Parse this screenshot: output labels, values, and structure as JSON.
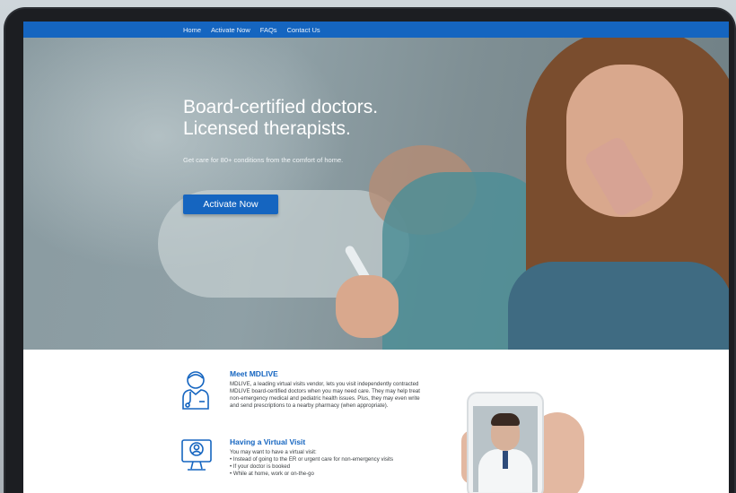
{
  "nav": {
    "items": [
      "Home",
      "Activate Now",
      "FAQs",
      "Contact Us"
    ]
  },
  "hero": {
    "title_line1": "Board-certified doctors.",
    "title_line2": "Licensed therapists.",
    "subtitle": "Get care for 80+ conditions from the comfort of home.",
    "cta_label": "Activate Now"
  },
  "sections": {
    "meet": {
      "title": "Meet MDLIVE",
      "body_lines": [
        "MDLIVE, a leading virtual visits vendor, lets you visit independently contracted",
        "MDLIVE board-certified doctors when you may need care. They may help treat",
        "non-emergency medical and pediatric health issues. Plus, they may even write",
        "and send prescriptions to a nearby pharmacy (when appropriate)."
      ],
      "icon": "doctor-icon"
    },
    "visit": {
      "title": "Having a Virtual Visit",
      "intro": "You may want to have a virtual visit:",
      "bullets": [
        "Instead of going to the ER or urgent care for non-emergency visits",
        "If your doctor is booked",
        "While at home, work or on-the-go"
      ],
      "icon": "video-call-icon"
    }
  },
  "colors": {
    "brand_blue": "#1565c0",
    "text_dark": "#3c4043"
  }
}
